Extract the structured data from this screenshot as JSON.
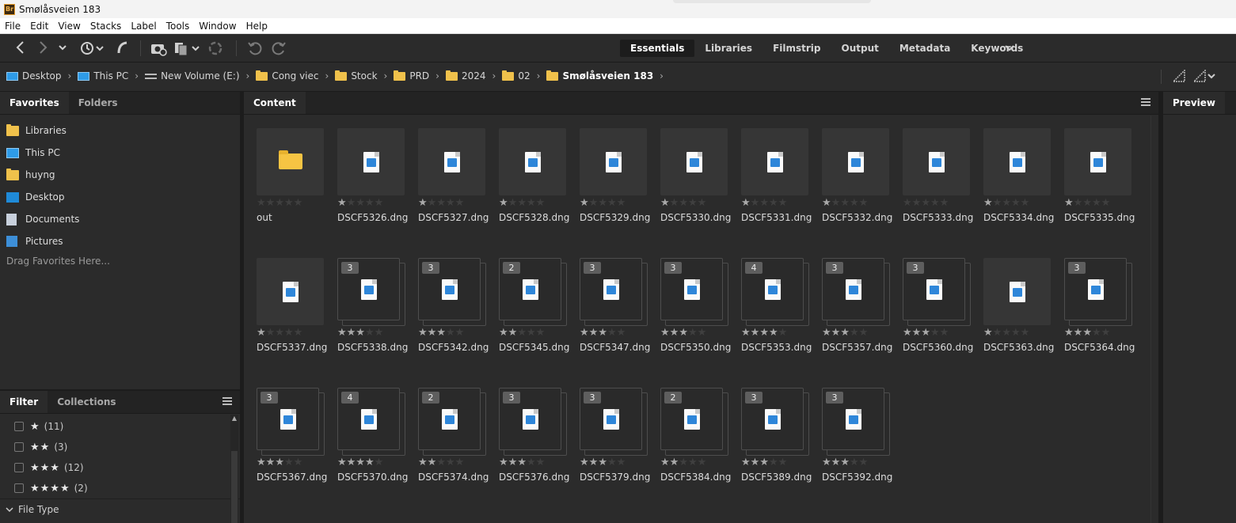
{
  "window": {
    "title": "Smølåsveien 183",
    "logo": "Br"
  },
  "menu": [
    "File",
    "Edit",
    "View",
    "Stacks",
    "Label",
    "Tools",
    "Window",
    "Help"
  ],
  "toolbar": {
    "icons": [
      "back-arrow-icon",
      "forward-arrow-icon",
      "chevron-down-icon",
      "recent-history-icon",
      "boomerang-icon",
      "camera-download-icon",
      "copy-pages-icon",
      "refine-icon",
      "undo-rotate-icon",
      "redo-rotate-icon"
    ],
    "workspaces": [
      "Essentials",
      "Libraries",
      "Filmstrip",
      "Output",
      "Metadata",
      "Keywords"
    ],
    "active_workspace": "Essentials"
  },
  "breadcrumb": [
    {
      "label": "Desktop",
      "icon": "monitor-icon"
    },
    {
      "label": "This PC",
      "icon": "monitor-icon"
    },
    {
      "label": "New Volume (E:)",
      "icon": "drive-icon"
    },
    {
      "label": "Cong viec",
      "icon": "folder-icon"
    },
    {
      "label": "Stock",
      "icon": "folder-icon"
    },
    {
      "label": "PRD",
      "icon": "folder-icon"
    },
    {
      "label": "2024",
      "icon": "folder-icon"
    },
    {
      "label": "02",
      "icon": "folder-icon"
    },
    {
      "label": "Smølåsveien 183",
      "icon": "folder-icon"
    }
  ],
  "left_panel": {
    "tabs": [
      "Favorites",
      "Folders"
    ],
    "favorites": [
      {
        "label": "Libraries",
        "icon": "folder-icon"
      },
      {
        "label": "This PC",
        "icon": "monitor-icon"
      },
      {
        "label": "huyng",
        "icon": "folder-icon"
      },
      {
        "label": "Desktop",
        "icon": "desktop-icon"
      },
      {
        "label": "Documents",
        "icon": "document-icon"
      },
      {
        "label": "Pictures",
        "icon": "pictures-icon"
      }
    ],
    "drag_hint": "Drag Favorites Here...",
    "filter_tabs": [
      "Filter",
      "Collections"
    ],
    "ratings": [
      {
        "stars": "★",
        "count": "(11)"
      },
      {
        "stars": "★★",
        "count": "(3)"
      },
      {
        "stars": "★★★",
        "count": "(12)"
      },
      {
        "stars": "★★★★",
        "count": "(2)"
      }
    ],
    "file_type_label": "File Type"
  },
  "content": {
    "tab": "Content",
    "items": [
      {
        "name": "out",
        "type": "folder",
        "rating": 0
      },
      {
        "name": "DSCF5326.dng",
        "rating": 1
      },
      {
        "name": "DSCF5327.dng",
        "rating": 1
      },
      {
        "name": "DSCF5328.dng",
        "rating": 1
      },
      {
        "name": "DSCF5329.dng",
        "rating": 1
      },
      {
        "name": "DSCF5330.dng",
        "rating": 1
      },
      {
        "name": "DSCF5331.dng",
        "rating": 1
      },
      {
        "name": "DSCF5332.dng",
        "rating": 1
      },
      {
        "name": "DSCF5333.dng",
        "rating": 0
      },
      {
        "name": "DSCF5334.dng",
        "rating": 1
      },
      {
        "name": "DSCF5335.dng",
        "rating": 1
      },
      {
        "name": "DSCF5337.dng",
        "rating": 1
      },
      {
        "name": "DSCF5338.dng",
        "rating": 3,
        "stack": "3"
      },
      {
        "name": "DSCF5342.dng",
        "rating": 3,
        "stack": "3"
      },
      {
        "name": "DSCF5345.dng",
        "rating": 2,
        "stack": "2"
      },
      {
        "name": "DSCF5347.dng",
        "rating": 3,
        "stack": "3"
      },
      {
        "name": "DSCF5350.dng",
        "rating": 3,
        "stack": "3"
      },
      {
        "name": "DSCF5353.dng",
        "rating": 4,
        "stack": "4"
      },
      {
        "name": "DSCF5357.dng",
        "rating": 3,
        "stack": "3"
      },
      {
        "name": "DSCF5360.dng",
        "rating": 3,
        "stack": "3"
      },
      {
        "name": "DSCF5363.dng",
        "rating": 1
      },
      {
        "name": "DSCF5364.dng",
        "rating": 3,
        "stack": "3"
      },
      {
        "name": "DSCF5367.dng",
        "rating": 3,
        "stack": "3"
      },
      {
        "name": "DSCF5370.dng",
        "rating": 4,
        "stack": "4"
      },
      {
        "name": "DSCF5374.dng",
        "rating": 2,
        "stack": "2"
      },
      {
        "name": "DSCF5376.dng",
        "rating": 3,
        "stack": "3"
      },
      {
        "name": "DSCF5379.dng",
        "rating": 3,
        "stack": "3"
      },
      {
        "name": "DSCF5384.dng",
        "rating": 2,
        "stack": "2"
      },
      {
        "name": "DSCF5389.dng",
        "rating": 3,
        "stack": "3"
      },
      {
        "name": "DSCF5392.dng",
        "rating": 3,
        "stack": "3"
      }
    ]
  },
  "preview_panel": {
    "tab": "Preview"
  }
}
